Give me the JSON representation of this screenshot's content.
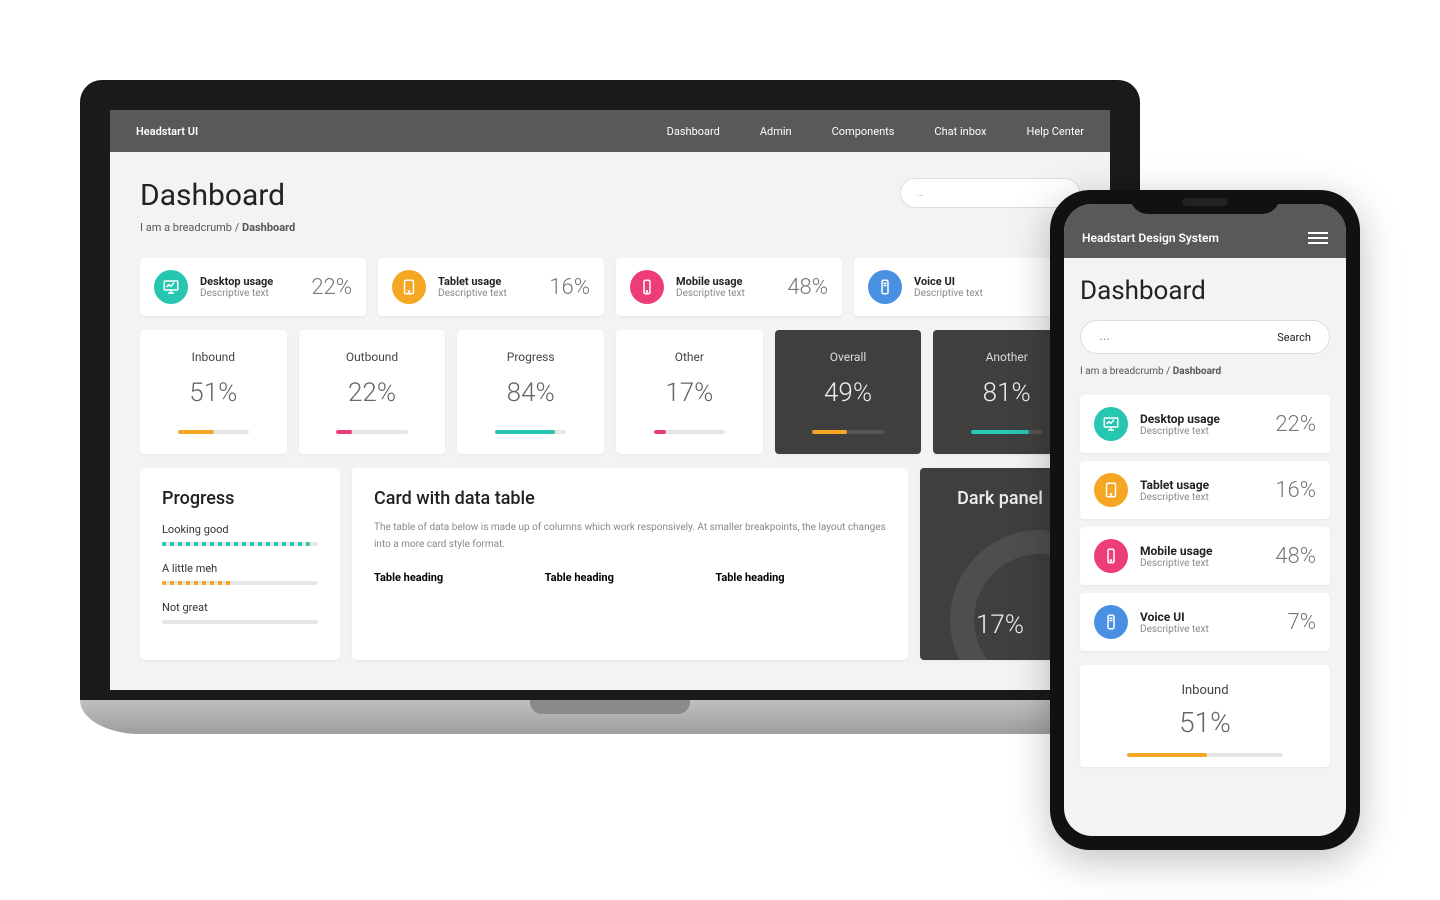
{
  "colors": {
    "teal": "#26c6b0",
    "orange": "#f5a623",
    "pink": "#ec3d7a",
    "blue": "#4a90e2"
  },
  "desktop": {
    "brand": "Headstart UI",
    "nav": [
      "Dashboard",
      "Admin",
      "Components",
      "Chat inbox",
      "Help Center"
    ],
    "title": "Dashboard",
    "search_placeholder": "…",
    "breadcrumb_prefix": "I am a breadcrumb / ",
    "breadcrumb_current": "Dashboard",
    "usage": [
      {
        "icon": "desktop",
        "color": "teal",
        "title": "Desktop usage",
        "desc": "Descriptive text",
        "pct": "22%"
      },
      {
        "icon": "tablet",
        "color": "orange",
        "title": "Tablet usage",
        "desc": "Descriptive text",
        "pct": "16%"
      },
      {
        "icon": "mobile",
        "color": "pink",
        "title": "Mobile usage",
        "desc": "Descriptive text",
        "pct": "48%"
      },
      {
        "icon": "voice",
        "color": "blue",
        "title": "Voice UI",
        "desc": "Descriptive text",
        "pct": ""
      }
    ],
    "stats": [
      {
        "label": "Inbound",
        "val": "51%",
        "bar": 51,
        "color": "orange",
        "dark": false
      },
      {
        "label": "Outbound",
        "val": "22%",
        "bar": 22,
        "color": "pink",
        "dark": false
      },
      {
        "label": "Progress",
        "val": "84%",
        "bar": 84,
        "color": "teal",
        "dark": false
      },
      {
        "label": "Other",
        "val": "17%",
        "bar": 17,
        "color": "pink",
        "dark": false
      },
      {
        "label": "Overall",
        "val": "49%",
        "bar": 49,
        "color": "orange",
        "dark": true
      },
      {
        "label": "Another",
        "val": "81%",
        "bar": 81,
        "color": "teal",
        "dark": true
      }
    ],
    "progress_panel": {
      "title": "Progress",
      "items": [
        {
          "label": "Looking good",
          "pct": 95,
          "color": "teal"
        },
        {
          "label": "A little meh",
          "pct": 45,
          "color": "orange"
        },
        {
          "label": "Not great",
          "pct": 0,
          "color": "pink"
        }
      ]
    },
    "table_panel": {
      "title": "Card with data table",
      "desc": "The table of data below is made up of columns which work responsively. At smaller breakpoints, the layout changes into a more card style format.",
      "headings": [
        "Table heading",
        "Table heading",
        "Table heading"
      ]
    },
    "dark_panel": {
      "title": "Dark panel",
      "value": "17%"
    }
  },
  "mobile": {
    "brand": "Headstart Design System",
    "title": "Dashboard",
    "search_placeholder": "…",
    "search_button": "Search",
    "breadcrumb_prefix": "I am a breadcrumb / ",
    "breadcrumb_current": "Dashboard",
    "usage": [
      {
        "icon": "desktop",
        "color": "teal",
        "title": "Desktop usage",
        "desc": "Descriptive text",
        "pct": "22%"
      },
      {
        "icon": "tablet",
        "color": "orange",
        "title": "Tablet usage",
        "desc": "Descriptive text",
        "pct": "16%"
      },
      {
        "icon": "mobile",
        "color": "pink",
        "title": "Mobile usage",
        "desc": "Descriptive text",
        "pct": "48%"
      },
      {
        "icon": "voice",
        "color": "blue",
        "title": "Voice UI",
        "desc": "Descriptive text",
        "pct": "7%"
      }
    ],
    "inbound": {
      "label": "Inbound",
      "val": "51%",
      "bar": 51,
      "color": "orange"
    }
  }
}
